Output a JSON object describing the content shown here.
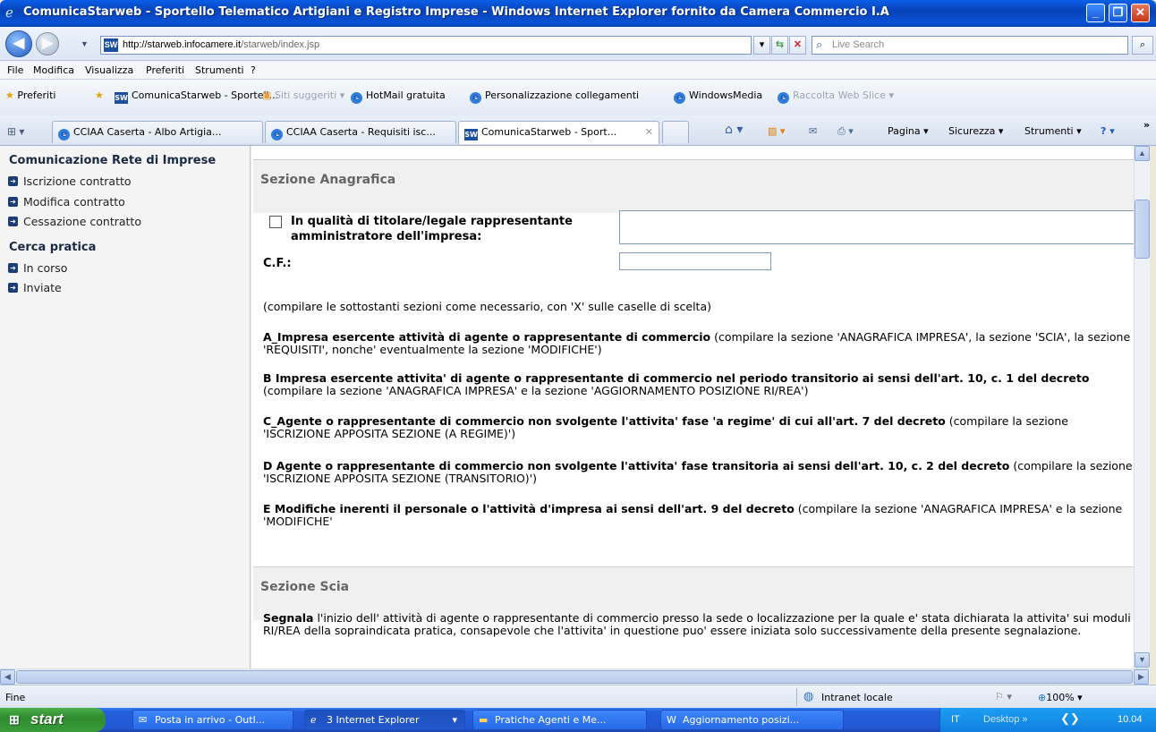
{
  "window": {
    "title": "ComunicaStarweb - Sportello Telematico Artigiani e Registro Imprese - Windows Internet Explorer fornito da Camera Commercio I.A"
  },
  "address": {
    "url_host": "http://starweb.infocamere.it",
    "url_path": "/starweb/index.jsp"
  },
  "search": {
    "placeholder": "Live Search"
  },
  "menu": [
    "File",
    "Modifica",
    "Visualizza",
    "Preferiti",
    "Strumenti",
    "?"
  ],
  "favorites": {
    "label": "Preferiti",
    "items": [
      "ComunicaStarweb - Sportell...",
      "Siti suggeriti ▾",
      "HotMail gratuita",
      "Personalizzazione collegamenti",
      "WindowsMedia",
      "Raccolta Web Slice ▾"
    ]
  },
  "tabs": [
    "CCIAA Caserta - Albo Artigia...",
    "CCIAA Caserta - Requisiti isc...",
    "ComunicaStarweb - Sport..."
  ],
  "commands": [
    "Pagina ▾",
    "Sicurezza ▾",
    "Strumenti ▾"
  ],
  "sidebar": {
    "section1": "Comunicazione Rete di Imprese",
    "items1": [
      "Iscrizione contratto",
      "Modifica contratto",
      "Cessazione contratto"
    ],
    "section2": "Cerca pratica",
    "items2": [
      "In corso",
      "Inviate"
    ]
  },
  "content": {
    "sec_anagrafica": "Sezione Anagrafica",
    "titolare_line1": "In qualità di titolare/legale rappresentante",
    "titolare_line2": "amministratore dell'impresa:",
    "cf_label": "C.F.:",
    "hint": "(compilare le sottostanti sezioni come necessario, con 'X' sulle caselle di scelta)",
    "opt_a_bold": "A_Impresa esercente attività di agente o rappresentante di commercio",
    "opt_a_text": " (compilare la sezione 'ANAGRAFICA IMPRESA', la sezione 'SCIA', la sezione 'REQUISITI', nonche' eventualmente la sezione 'MODIFICHE')",
    "opt_b_bold": "B Impresa esercente attivita' di agente o rappresentante di commercio nel periodo transitorio ai sensi dell'art. 10, c. 1 del decreto",
    "opt_b_text": " (compilare la sezione 'ANAGRAFICA IMPRESA' e la sezione 'AGGIORNAMENTO POSIZIONE RI/REA')",
    "opt_c_bold": "C_Agente o rappresentante di commercio non svolgente l'attivita' fase 'a regime' di cui all'art. 7 del decreto",
    "opt_c_text": " (compilare la sezione 'ISCRIZIONE APPOSITA SEZIONE (A REGIME)')",
    "opt_d_bold": "D Agente o rappresentante di commercio non svolgente l'attivita' fase transitoria ai sensi dell'art. 10, c. 2 del decreto",
    "opt_d_text": " (compilare la sezione 'ISCRIZIONE APPOSITA SEZIONE (TRANSITORIO)')",
    "opt_e_bold": "E Modifiche inerenti il personale o l'attività d'impresa ai sensi dell'art. 9 del decreto",
    "opt_e_text": " (compilare la sezione 'ANAGRAFICA IMPRESA' e la sezione 'MODIFICHE'",
    "sec_scia": "Sezione Scia",
    "segnala_bold": "Segnala",
    "segnala_text": " l'inizio dell' attività di agente o rappresentante di commercio presso la sede o localizzazione per la quale e' stata dichiarata la attivita' sui moduli RI/REA della sopraindicata pratica, consapevole che l'attivita' in questione puo' essere iniziata solo successivamente della presente segnalazione."
  },
  "status": {
    "left": "Fine",
    "zone": "Intranet locale",
    "zoom": "100%"
  },
  "taskbar": {
    "start": "start",
    "tasks": [
      "Posta in arrivo - Outl...",
      "3 Internet Explorer",
      "Pratiche Agenti e Me...",
      "Aggiornamento posizi..."
    ],
    "lang": "IT",
    "desktop": "Desktop",
    "clock": "10.04"
  }
}
